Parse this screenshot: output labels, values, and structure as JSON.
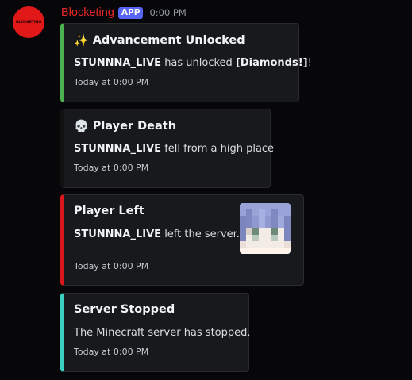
{
  "bot": {
    "name": "Blocketing",
    "badge": "APP",
    "time": "0:00 PM",
    "avatar_text": "BLOCKETING",
    "avatar_color": "#e01818",
    "name_color": "#e8282b",
    "badge_color": "#5865f2"
  },
  "embeds": [
    {
      "icon": "✨",
      "icon_name": "sparkles-icon",
      "title": "Advancement Unlocked",
      "player": "STUNNNA_LIVE",
      "text": " has unlocked ",
      "item": "[Diamonds!]",
      "suffix": "!",
      "footer": "Today at 0:00 PM",
      "color": "#4caf50"
    },
    {
      "icon": "💀",
      "icon_name": "skull-icon",
      "title": "Player Death",
      "player": "STUNNNA_LIVE",
      "text": " fell from a high place",
      "footer": "Today at 0:00 PM",
      "color": "#111111"
    },
    {
      "title": "Player Left",
      "player": "STUNNNA_LIVE",
      "text": " left the server.",
      "footer": "Today at 0:00 PM",
      "color": "#d9161c"
    },
    {
      "title": "Server Stopped",
      "text": "The Minecraft server has stopped.",
      "footer": "Today at 0:00 PM",
      "color": "#3ccfc1"
    }
  ]
}
